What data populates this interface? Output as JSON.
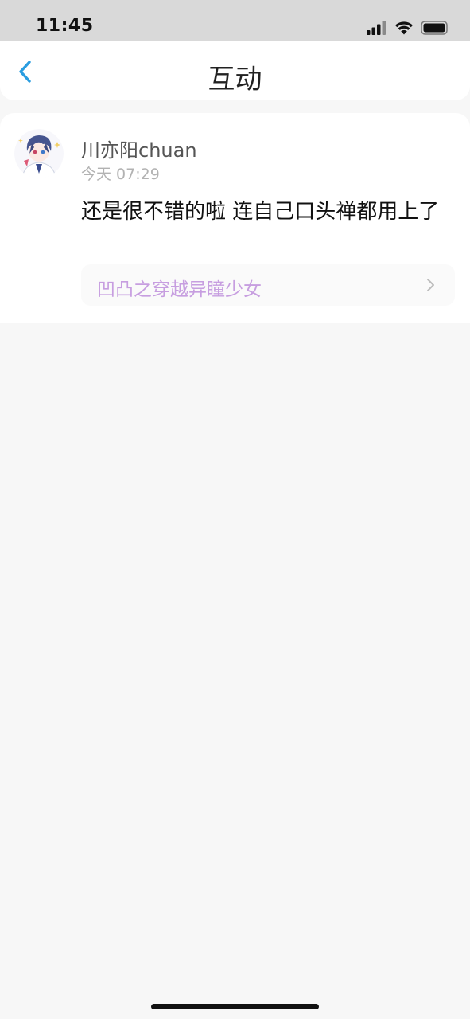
{
  "status_bar": {
    "time": "11:45"
  },
  "header": {
    "title": "互动",
    "back_icon": "chevron-left-icon"
  },
  "comment_card": {
    "username": "川亦阳chuan",
    "timestamp": "今天 07:29",
    "text": "还是很不错的啦 连自己口头禅都用上了",
    "linked_title": "凹凸之穿越异瞳少女"
  },
  "colors": {
    "accent_blue": "#2a9de0",
    "link_text": "#c79ee0",
    "page_background": "#f7f7f7",
    "status_bar_background": "#d9d9d9"
  }
}
